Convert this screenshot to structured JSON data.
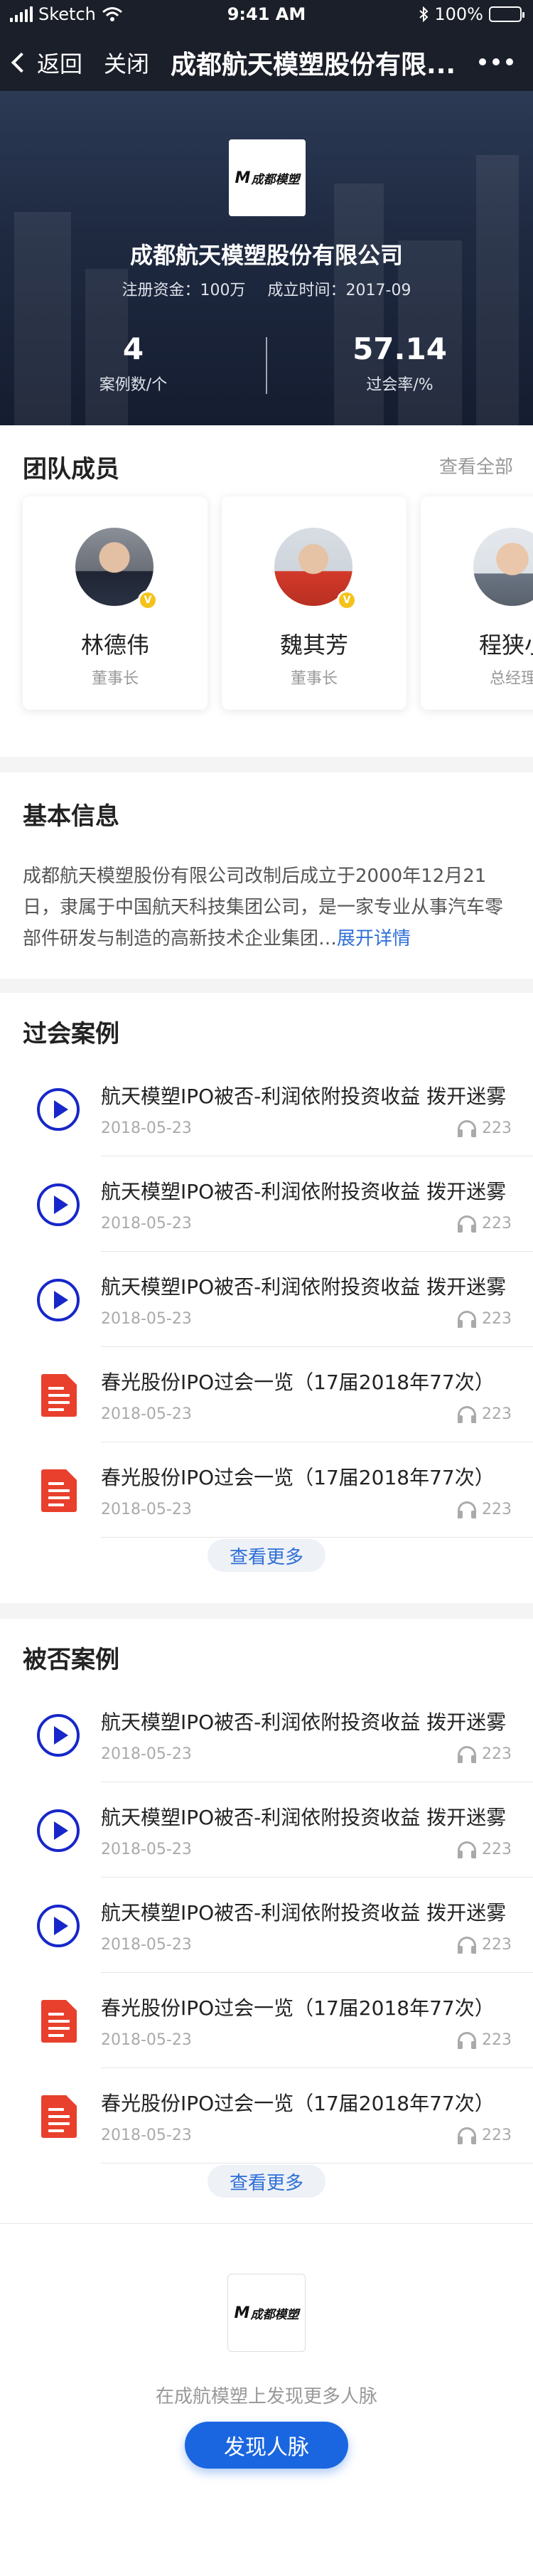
{
  "status_bar": {
    "carrier": "Sketch",
    "time": "9:41 AM",
    "battery": "100%"
  },
  "nav": {
    "back_label": "返回",
    "close_label": "关闭",
    "title": "成都航天模塑股份有限..."
  },
  "company": {
    "logo_text": "成都模塑",
    "name": "成都航天模塑股份有限公司",
    "registered_capital": "注册资金：100万",
    "founded": "成立时间：2017-09",
    "stats": [
      {
        "value": "4",
        "label": "案例数/个"
      },
      {
        "value": "57.14",
        "label": "过会率/%"
      }
    ]
  },
  "team": {
    "title": "团队成员",
    "view_all": "查看全部",
    "members": [
      {
        "name": "林德伟",
        "role": "董事长"
      },
      {
        "name": "魏其芳",
        "role": "董事长"
      },
      {
        "name": "程狭小",
        "role": "总经理"
      }
    ]
  },
  "basic_info": {
    "title": "基本信息",
    "text": "成都航天模塑股份有限公司改制后成立于2000年12月21日，隶属于中国航天科技集团公司，是一家专业从事汽车零部件研发与制造的高新技术企业集团…",
    "expand": "展开详情"
  },
  "passed_cases": {
    "title": "过会案例",
    "more": "查看更多",
    "items": [
      {
        "type": "audio",
        "title": "航天模塑IPO被否-利润依附投资收益 拨开迷雾",
        "date": "2018-05-23",
        "plays": "223"
      },
      {
        "type": "audio",
        "title": "航天模塑IPO被否-利润依附投资收益 拨开迷雾",
        "date": "2018-05-23",
        "plays": "223"
      },
      {
        "type": "audio",
        "title": "航天模塑IPO被否-利润依附投资收益 拨开迷雾",
        "date": "2018-05-23",
        "plays": "223"
      },
      {
        "type": "doc",
        "title": "春光股份IPO过会一览（17届2018年77次）",
        "date": "2018-05-23",
        "plays": "223"
      },
      {
        "type": "doc",
        "title": "春光股份IPO过会一览（17届2018年77次）",
        "date": "2018-05-23",
        "plays": "223"
      }
    ]
  },
  "rejected_cases": {
    "title": "被否案例",
    "more": "查看更多",
    "items": [
      {
        "type": "audio",
        "title": "航天模塑IPO被否-利润依附投资收益 拨开迷雾",
        "date": "2018-05-23",
        "plays": "223"
      },
      {
        "type": "audio",
        "title": "航天模塑IPO被否-利润依附投资收益 拨开迷雾",
        "date": "2018-05-23",
        "plays": "223"
      },
      {
        "type": "audio",
        "title": "航天模塑IPO被否-利润依附投资收益 拨开迷雾",
        "date": "2018-05-23",
        "plays": "223"
      },
      {
        "type": "doc",
        "title": "春光股份IPO过会一览（17届2018年77次）",
        "date": "2018-05-23",
        "plays": "223"
      },
      {
        "type": "doc",
        "title": "春光股份IPO过会一览（17届2018年77次）",
        "date": "2018-05-23",
        "plays": "223"
      }
    ]
  },
  "footer": {
    "logo_text": "成都模塑",
    "text": "在成航模塑上发现更多人脉",
    "button": "发现人脉"
  }
}
